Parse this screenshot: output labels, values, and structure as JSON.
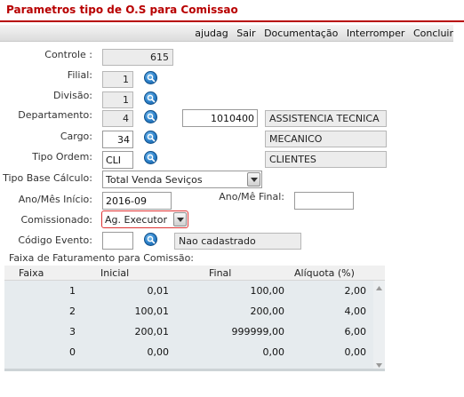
{
  "title": "Parametros tipo de O.S para Comissao",
  "toolbar": {
    "links": [
      "ajudag",
      "Sair",
      "Documentação",
      "Interromper",
      "Concluir"
    ]
  },
  "form": {
    "controle": {
      "label": "Controle :",
      "value": "615"
    },
    "filial": {
      "label": "Filial:",
      "value": "1"
    },
    "divisao": {
      "label": "Divisão:",
      "value": "1"
    },
    "departamento": {
      "label": "Departamento:",
      "value": "4",
      "code": "1010400",
      "name": "ASSISTENCIA TECNICA"
    },
    "cargo": {
      "label": "Cargo:",
      "value": "34",
      "name": "MECANICO"
    },
    "tipo_ordem": {
      "label": "Tipo Ordem:",
      "value": "CLI",
      "name": "CLIENTES"
    },
    "tipo_base": {
      "label": "Tipo Base Cálculo:",
      "value": "Total Venda Seviços"
    },
    "ano_mes_inicio": {
      "label": "Ano/Mês Início:",
      "value": "2016-09"
    },
    "ano_mes_final": {
      "label": "Ano/Mê Final:",
      "value": ""
    },
    "comissionado": {
      "label": "Comissionado:",
      "value": "Ag. Executor"
    },
    "codigo_evento": {
      "label": "Código Evento:",
      "value": "",
      "name": "Nao cadastrado"
    }
  },
  "faixa": {
    "section_label": "Faixa de Faturamento para Comissão:",
    "columns": [
      "Faixa",
      "Inicial",
      "Final",
      "Alíquota (%)"
    ],
    "rows": [
      [
        "1",
        "0,01",
        "100,00",
        "2,00"
      ],
      [
        "2",
        "100,01",
        "200,00",
        "4,00"
      ],
      [
        "3",
        "200,01",
        "999999,00",
        "6,00"
      ],
      [
        "0",
        "0,00",
        "0,00",
        "0,00"
      ]
    ]
  },
  "colors": {
    "title": "#b80000",
    "icon_blue": "#2b7fc8",
    "readonly_bg": "#ececec",
    "grid_bg": "#e6ebee"
  },
  "icons": {
    "lookup": "magnifier-icon",
    "dropdown": "chevron-down-icon",
    "scroll_up": "scroll-up-arrow-icon",
    "scroll_down": "scroll-down-arrow-icon"
  }
}
